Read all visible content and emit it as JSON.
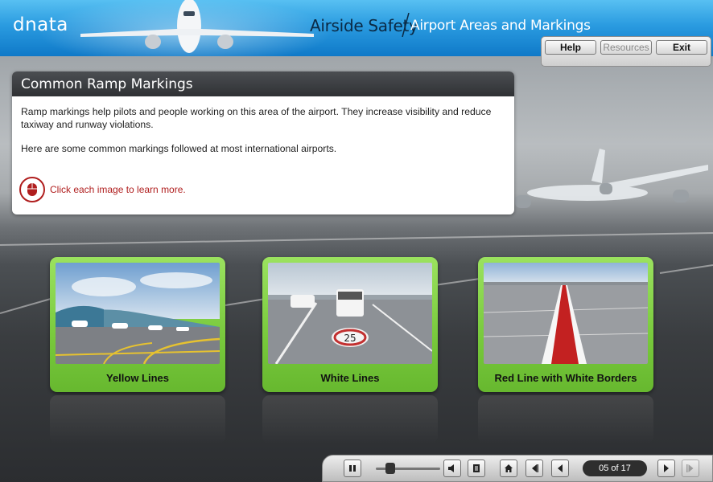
{
  "header": {
    "logo": "dnata",
    "course_title": "Airside Safety",
    "course_subtitle": "Airport Areas and Markings",
    "buttons": [
      {
        "label": "Help",
        "enabled": true
      },
      {
        "label": "Resources",
        "enabled": false
      },
      {
        "label": "Exit",
        "enabled": true
      }
    ]
  },
  "panel": {
    "title": "Common Ramp Markings",
    "paragraph1": "Ramp markings help pilots and people working on this area of the airport. They increase visibility and reduce taxiway and runway violations.",
    "paragraph2": "Here are some common markings followed at most international airports.",
    "instruction": "Click each image to learn more."
  },
  "cards": [
    {
      "label": "Yellow Lines"
    },
    {
      "label": "White Lines",
      "marking_text": "25"
    },
    {
      "label": "Red Line with White Borders"
    }
  ],
  "player": {
    "page_counter": "05 of 17",
    "icons": [
      "pause-icon",
      "volume-icon",
      "transcript-icon",
      "home-icon",
      "first-page-icon",
      "previous-icon",
      "next-icon",
      "last-page-icon"
    ]
  },
  "colors": {
    "header_blue": "#1d8ad6",
    "card_green": "#78c93c",
    "instruction_red": "#b01e1e"
  }
}
